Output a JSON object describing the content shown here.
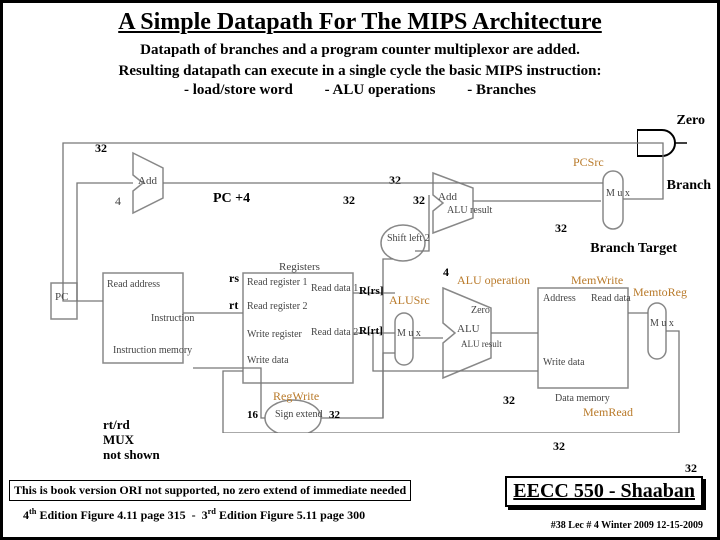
{
  "title": "A Simple Datapath For The MIPS Architecture",
  "subtitle": "Datapath of branches and a program counter multiplexor are added.",
  "description": "Resulting datapath can execute in a single cycle the basic MIPS instruction:",
  "bullets": {
    "b1": "- load/store word",
    "b2": "- ALU operations",
    "b3": "- Branches"
  },
  "bus_widths": {
    "pc_out": "32",
    "add_shift": "32",
    "shift_in": "32",
    "shift_out": "32",
    "alu_result_mux": "32",
    "alu_out": "32",
    "mem_addr": "32",
    "final": "32",
    "alu_op": "4",
    "sign_out": "32",
    "rt_field": "16"
  },
  "labels": {
    "pc_plus_4": "PC +4",
    "rs": "rs",
    "rt": "rt",
    "R_rs": "R[rs]",
    "R_rt": "R[rt]",
    "rt_rd_note_l1": "rt/rd",
    "rt_rd_note_l2": "MUX",
    "rt_rd_note_l3": "not shown",
    "zero": "Zero",
    "branch": "Branch",
    "branch_target": "Branch Target"
  },
  "block_labels": {
    "pc": "PC",
    "add1": "Add",
    "add2": "Add",
    "alu_result": "ALU result",
    "four": "4",
    "shift": "Shift left 2",
    "mux": "M u x",
    "read_addr": "Read address",
    "instr_mem": "Instruction memory",
    "instruction": "Instruction",
    "registers": "Registers",
    "read_reg1": "Read register 1",
    "read_reg2": "Read register 2",
    "write_reg": "Write register",
    "write_data": "Write data",
    "read_data1": "Read data 1",
    "read_data2": "Read data 2",
    "alu": "ALU",
    "alu_zero": "Zero",
    "alu_res2": "ALU result",
    "sign_extend": "Sign extend",
    "mem_address": "Address",
    "mem_read_data": "Read data",
    "mem_write_data": "Write data",
    "data_memory": "Data memory"
  },
  "control_signals": {
    "pc_src": "PCSrc",
    "alu_src": "ALUSrc",
    "alu_operation": "ALU operation",
    "mem_write": "MemWrite",
    "mem_to_reg": "MemtoReg",
    "mem_read": "MemRead",
    "reg_write": "RegWrite"
  },
  "footer": {
    "note": "This is book version ORI not supported, no zero extend of immediate needed",
    "editions": "4th Edition Figure 4.11 page 315  -  3rd Edition Figure 5.11 page 300",
    "course": "EECC 550 - Shaaban",
    "slide": "#38  Lec # 4  Winter 2009  12-15-2009"
  }
}
